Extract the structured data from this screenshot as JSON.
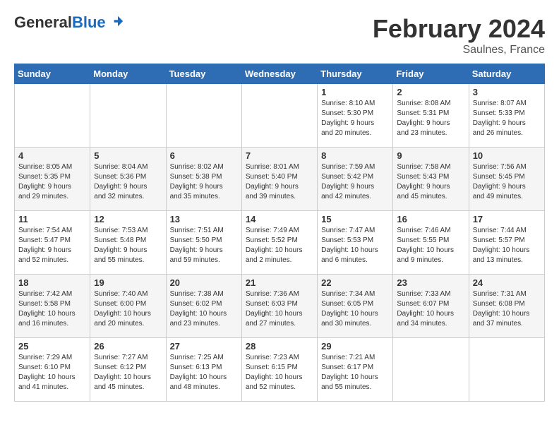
{
  "header": {
    "logo_general": "General",
    "logo_blue": "Blue",
    "month_title": "February 2024",
    "location": "Saulnes, France"
  },
  "weekdays": [
    "Sunday",
    "Monday",
    "Tuesday",
    "Wednesday",
    "Thursday",
    "Friday",
    "Saturday"
  ],
  "weeks": [
    [
      {
        "day": "",
        "info": ""
      },
      {
        "day": "",
        "info": ""
      },
      {
        "day": "",
        "info": ""
      },
      {
        "day": "",
        "info": ""
      },
      {
        "day": "1",
        "info": "Sunrise: 8:10 AM\nSunset: 5:30 PM\nDaylight: 9 hours\nand 20 minutes."
      },
      {
        "day": "2",
        "info": "Sunrise: 8:08 AM\nSunset: 5:31 PM\nDaylight: 9 hours\nand 23 minutes."
      },
      {
        "day": "3",
        "info": "Sunrise: 8:07 AM\nSunset: 5:33 PM\nDaylight: 9 hours\nand 26 minutes."
      }
    ],
    [
      {
        "day": "4",
        "info": "Sunrise: 8:05 AM\nSunset: 5:35 PM\nDaylight: 9 hours\nand 29 minutes."
      },
      {
        "day": "5",
        "info": "Sunrise: 8:04 AM\nSunset: 5:36 PM\nDaylight: 9 hours\nand 32 minutes."
      },
      {
        "day": "6",
        "info": "Sunrise: 8:02 AM\nSunset: 5:38 PM\nDaylight: 9 hours\nand 35 minutes."
      },
      {
        "day": "7",
        "info": "Sunrise: 8:01 AM\nSunset: 5:40 PM\nDaylight: 9 hours\nand 39 minutes."
      },
      {
        "day": "8",
        "info": "Sunrise: 7:59 AM\nSunset: 5:42 PM\nDaylight: 9 hours\nand 42 minutes."
      },
      {
        "day": "9",
        "info": "Sunrise: 7:58 AM\nSunset: 5:43 PM\nDaylight: 9 hours\nand 45 minutes."
      },
      {
        "day": "10",
        "info": "Sunrise: 7:56 AM\nSunset: 5:45 PM\nDaylight: 9 hours\nand 49 minutes."
      }
    ],
    [
      {
        "day": "11",
        "info": "Sunrise: 7:54 AM\nSunset: 5:47 PM\nDaylight: 9 hours\nand 52 minutes."
      },
      {
        "day": "12",
        "info": "Sunrise: 7:53 AM\nSunset: 5:48 PM\nDaylight: 9 hours\nand 55 minutes."
      },
      {
        "day": "13",
        "info": "Sunrise: 7:51 AM\nSunset: 5:50 PM\nDaylight: 9 hours\nand 59 minutes."
      },
      {
        "day": "14",
        "info": "Sunrise: 7:49 AM\nSunset: 5:52 PM\nDaylight: 10 hours\nand 2 minutes."
      },
      {
        "day": "15",
        "info": "Sunrise: 7:47 AM\nSunset: 5:53 PM\nDaylight: 10 hours\nand 6 minutes."
      },
      {
        "day": "16",
        "info": "Sunrise: 7:46 AM\nSunset: 5:55 PM\nDaylight: 10 hours\nand 9 minutes."
      },
      {
        "day": "17",
        "info": "Sunrise: 7:44 AM\nSunset: 5:57 PM\nDaylight: 10 hours\nand 13 minutes."
      }
    ],
    [
      {
        "day": "18",
        "info": "Sunrise: 7:42 AM\nSunset: 5:58 PM\nDaylight: 10 hours\nand 16 minutes."
      },
      {
        "day": "19",
        "info": "Sunrise: 7:40 AM\nSunset: 6:00 PM\nDaylight: 10 hours\nand 20 minutes."
      },
      {
        "day": "20",
        "info": "Sunrise: 7:38 AM\nSunset: 6:02 PM\nDaylight: 10 hours\nand 23 minutes."
      },
      {
        "day": "21",
        "info": "Sunrise: 7:36 AM\nSunset: 6:03 PM\nDaylight: 10 hours\nand 27 minutes."
      },
      {
        "day": "22",
        "info": "Sunrise: 7:34 AM\nSunset: 6:05 PM\nDaylight: 10 hours\nand 30 minutes."
      },
      {
        "day": "23",
        "info": "Sunrise: 7:33 AM\nSunset: 6:07 PM\nDaylight: 10 hours\nand 34 minutes."
      },
      {
        "day": "24",
        "info": "Sunrise: 7:31 AM\nSunset: 6:08 PM\nDaylight: 10 hours\nand 37 minutes."
      }
    ],
    [
      {
        "day": "25",
        "info": "Sunrise: 7:29 AM\nSunset: 6:10 PM\nDaylight: 10 hours\nand 41 minutes."
      },
      {
        "day": "26",
        "info": "Sunrise: 7:27 AM\nSunset: 6:12 PM\nDaylight: 10 hours\nand 45 minutes."
      },
      {
        "day": "27",
        "info": "Sunrise: 7:25 AM\nSunset: 6:13 PM\nDaylight: 10 hours\nand 48 minutes."
      },
      {
        "day": "28",
        "info": "Sunrise: 7:23 AM\nSunset: 6:15 PM\nDaylight: 10 hours\nand 52 minutes."
      },
      {
        "day": "29",
        "info": "Sunrise: 7:21 AM\nSunset: 6:17 PM\nDaylight: 10 hours\nand 55 minutes."
      },
      {
        "day": "",
        "info": ""
      },
      {
        "day": "",
        "info": ""
      }
    ]
  ]
}
